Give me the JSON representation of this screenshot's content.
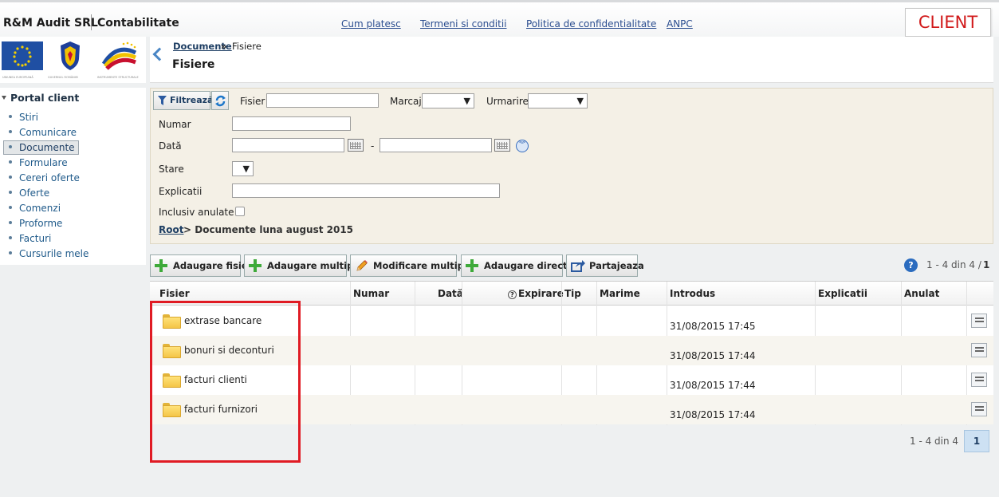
{
  "header": {
    "company": "R&M Audit SRL",
    "app_name": "Contabilitate",
    "links": [
      "Cum platesc",
      "Termeni si conditii",
      "Politica de confidentialitate",
      "ANPC"
    ],
    "client_label": "CLIENT"
  },
  "logos": {
    "captions": [
      "UNIUNEA EUROPEANĂ",
      "GUVERNUL ROMÂNIEI",
      "INSTRUMENTE STRUCTURALE"
    ]
  },
  "sidebar": {
    "title": "Portal client",
    "items": [
      "Stiri",
      "Comunicare",
      "Documente",
      "Formulare",
      "Cereri oferte",
      "Oferte",
      "Comenzi",
      "Proforme",
      "Facturi",
      "Cursurile mele"
    ],
    "active": "Documente"
  },
  "breadcrumb": {
    "link": "Documente",
    "separator": "»",
    "current": "Fisiere",
    "page_title": "Fisiere"
  },
  "filter": {
    "filter_button": "Filtrează",
    "fisier_label": "Fisier",
    "marcaj_label": "Marcaj",
    "urmarire_label": "Urmarire",
    "numar_label": "Numar",
    "data_label": "Dată",
    "date_separator": "-",
    "stare_label": "Stare",
    "explicatii_label": "Explicatii",
    "inclusiv_anulate_label": "Inclusiv anulate",
    "path_root": "Root",
    "path_rest": "> Documente luna august 2015"
  },
  "toolbar": {
    "buttons": [
      "Adaugare fisier",
      "Adaugare multipla",
      "Modificare multipla",
      "Adaugare director",
      "Partajeaza"
    ],
    "pager_text": "1 - 4 din 4 /",
    "pager_page": "1"
  },
  "grid": {
    "columns": [
      "Fisier",
      "Numar",
      "Dată",
      "Expirare",
      "Tip",
      "Marime",
      "Introdus",
      "Explicatii",
      "Anulat"
    ],
    "rows": [
      {
        "name": "extrase bancare",
        "introdus": "31/08/2015 17:45"
      },
      {
        "name": "bonuri si deconturi",
        "introdus": "31/08/2015 17:44"
      },
      {
        "name": "facturi clienti",
        "introdus": "31/08/2015 17:44"
      },
      {
        "name": "facturi furnizori",
        "introdus": "31/08/2015 17:44"
      }
    ]
  },
  "pager_bottom": {
    "text": "1 - 4 din 4",
    "page": "1"
  },
  "colors": {
    "client_red": "#d1191a",
    "link_blue": "#2a4d8f",
    "highlight_red": "#e01b24",
    "filter_bg": "#f4f0e6",
    "add_green": "#3eaa3a"
  }
}
